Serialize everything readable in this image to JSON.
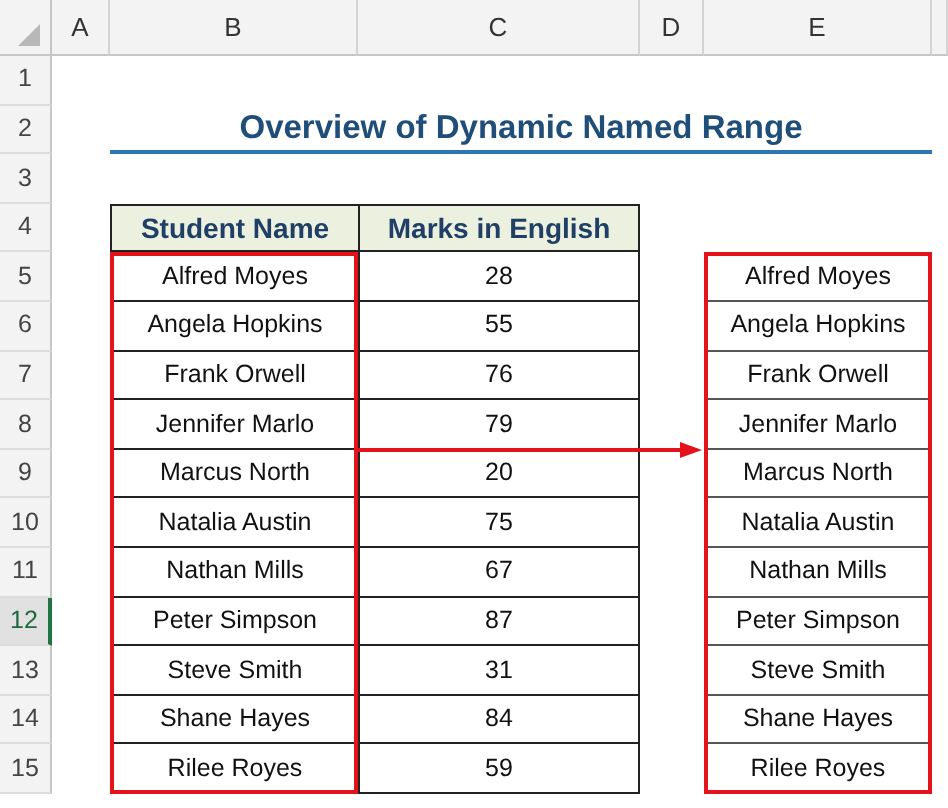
{
  "column_headers": [
    "A",
    "B",
    "C",
    "D",
    "E"
  ],
  "row_headers": [
    {
      "label": "1",
      "selected": false
    },
    {
      "label": "2",
      "selected": false
    },
    {
      "label": "3",
      "selected": false
    },
    {
      "label": "4",
      "selected": false
    },
    {
      "label": "5",
      "selected": false
    },
    {
      "label": "6",
      "selected": false
    },
    {
      "label": "7",
      "selected": false
    },
    {
      "label": "8",
      "selected": false
    },
    {
      "label": "9",
      "selected": false
    },
    {
      "label": "10",
      "selected": false
    },
    {
      "label": "11",
      "selected": false
    },
    {
      "label": "12",
      "selected": true
    },
    {
      "label": "13",
      "selected": false
    },
    {
      "label": "14",
      "selected": false
    },
    {
      "label": "15",
      "selected": false
    }
  ],
  "title": "Overview of Dynamic Named Range",
  "table": {
    "columns": [
      "Student Name",
      "Marks in English"
    ],
    "rows": [
      [
        "Alfred Moyes",
        "28"
      ],
      [
        "Angela Hopkins",
        "55"
      ],
      [
        "Frank Orwell",
        "76"
      ],
      [
        "Jennifer Marlo",
        "79"
      ],
      [
        "Marcus North",
        "20"
      ],
      [
        "Natalia Austin",
        "75"
      ],
      [
        "Nathan Mills",
        "67"
      ],
      [
        "Peter Simpson",
        "87"
      ],
      [
        "Steve Smith",
        "31"
      ],
      [
        "Shane Hayes",
        "84"
      ],
      [
        "Rilee Royes",
        "59"
      ]
    ]
  },
  "named_range_output": [
    "Alfred Moyes",
    "Angela Hopkins",
    "Frank Orwell",
    "Jennifer Marlo",
    "Marcus North",
    "Natalia Austin",
    "Nathan Mills",
    "Peter Simpson",
    "Steve Smith",
    "Shane Hayes",
    "Rilee Royes"
  ]
}
